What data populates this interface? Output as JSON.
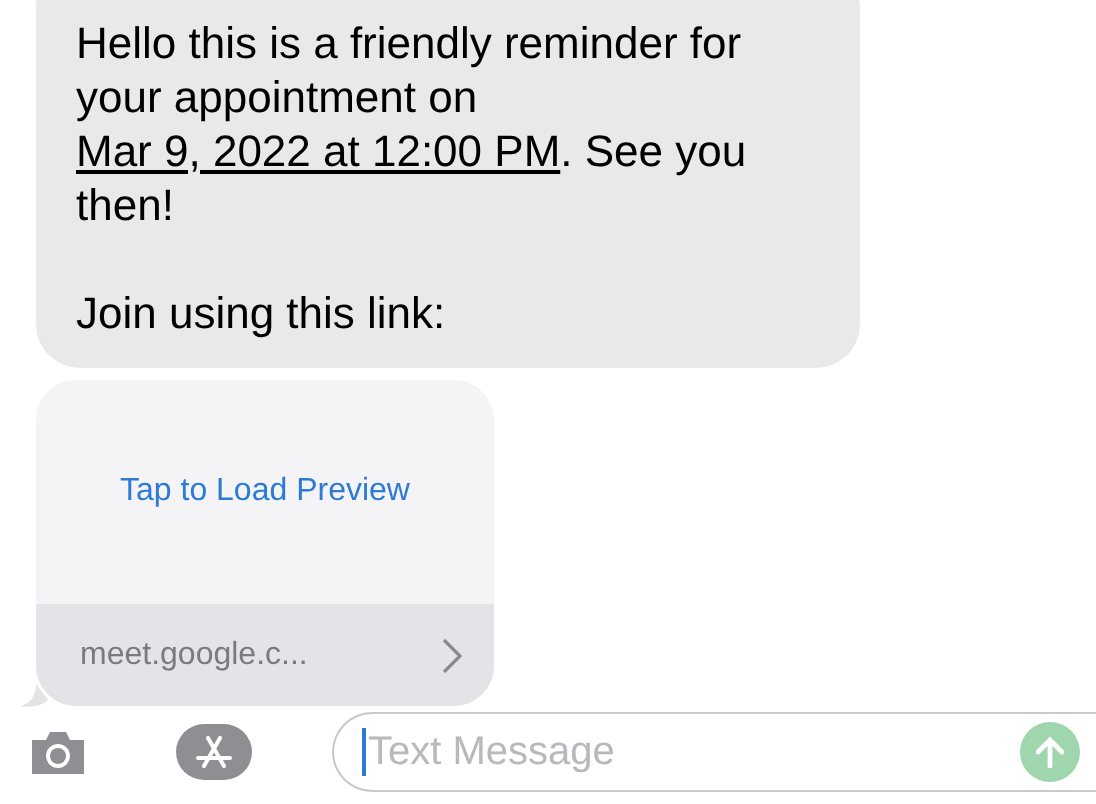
{
  "messages": [
    {
      "kind": "text",
      "before": "Hello this is a friendly reminder for your appointment on ",
      "link": "Mar 9, 2022 at 12:00 PM",
      "after": ". See you then!",
      "second_paragraph": "Join using this link:"
    },
    {
      "kind": "link_preview",
      "action": "Tap to Load Preview",
      "domain": "meet.google.c..."
    }
  ],
  "composer": {
    "placeholder": "Text Message"
  }
}
